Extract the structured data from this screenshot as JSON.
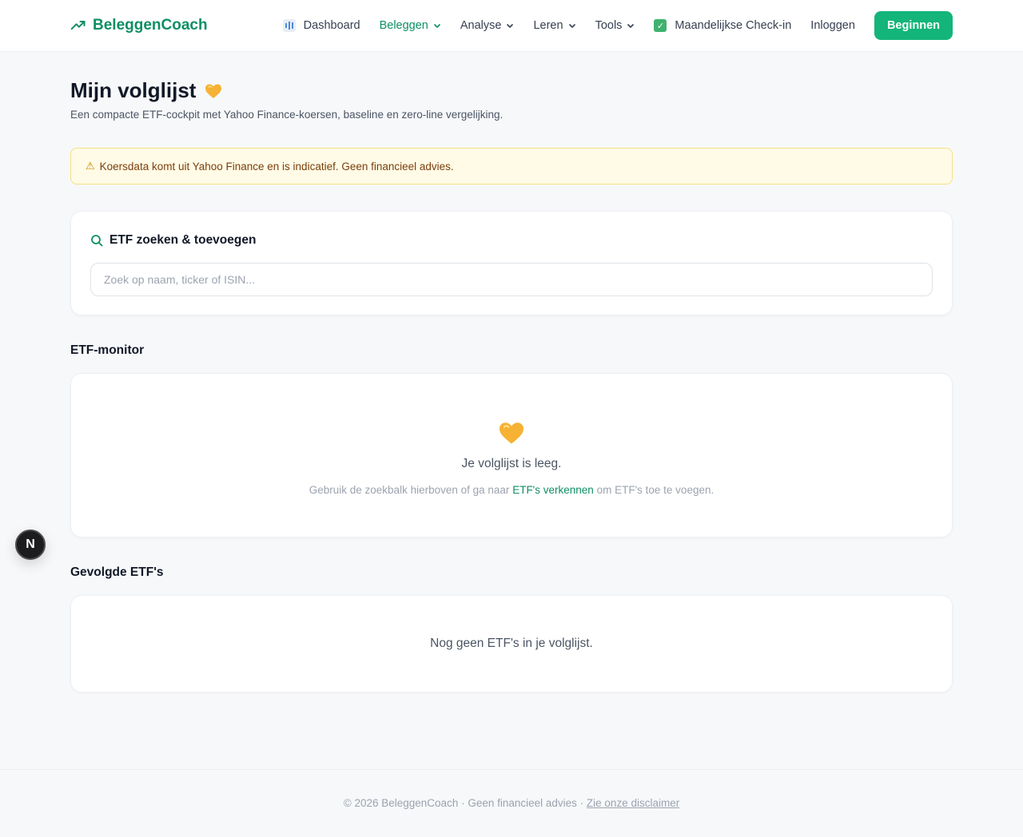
{
  "header": {
    "brand": "BeleggenCoach",
    "nav": [
      {
        "label": "Dashboard",
        "icon": "bar-chart-icon"
      },
      {
        "label": "Beleggen",
        "dropdown": true,
        "active": true
      },
      {
        "label": "Analyse",
        "dropdown": true
      },
      {
        "label": "Leren",
        "dropdown": true
      },
      {
        "label": "Tools",
        "dropdown": true
      },
      {
        "label": "Maandelijkse Check-in",
        "icon": "checkbox-icon"
      },
      {
        "label": "Inloggen"
      }
    ],
    "cta": "Beginnen"
  },
  "page": {
    "title": "Mijn volglijst",
    "subtitle": "Een compacte ETF-cockpit met Yahoo Finance-koersen, baseline en zero-line vergelijking."
  },
  "warning": "Koersdata komt uit Yahoo Finance en is indicatief. Geen financieel advies.",
  "search": {
    "heading": "ETF zoeken & toevoegen",
    "placeholder": "Zoek op naam, ticker of ISIN...",
    "value": ""
  },
  "monitor": {
    "title": "ETF-monitor",
    "empty_title": "Je volglijst is leeg.",
    "empty_sub_before": "Gebruik de zoekbalk hierboven of ga naar",
    "empty_link": "ETF's verkennen",
    "empty_sub_after": "om ETF's toe te voegen."
  },
  "followed": {
    "title": "Gevolgde ETF's",
    "empty": "Nog geen ETF's in je volglijst."
  },
  "fab_label": "N",
  "footer": {
    "text": "© 2026 BeleggenCoach · Geen financieel advies ·",
    "link": "Zie onze disclaimer"
  },
  "colors": {
    "brand": "#0e8f63",
    "cta": "#13b57a",
    "warning_bg": "#fffbe6",
    "warning_border": "#f6df86",
    "heart": "#f5b234"
  }
}
